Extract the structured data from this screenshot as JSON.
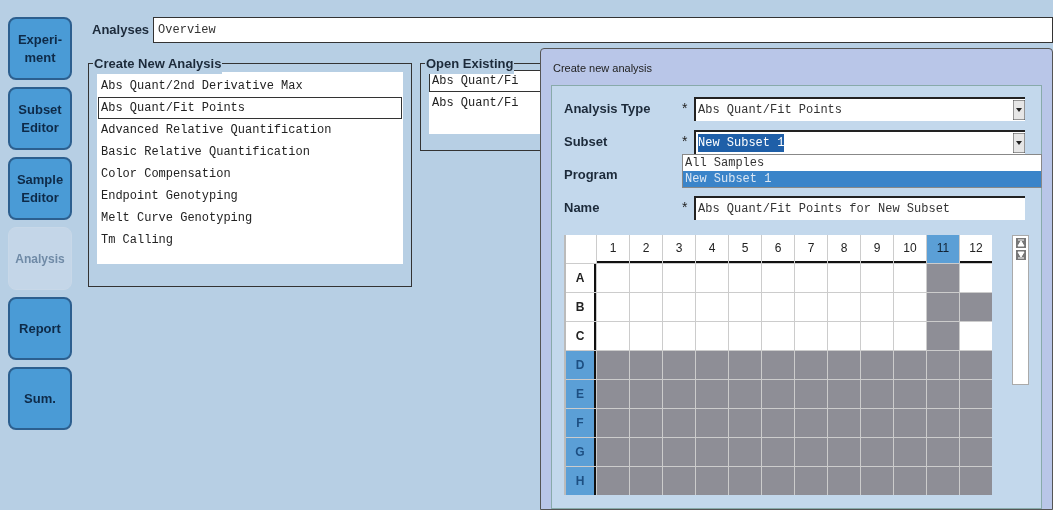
{
  "sidebar": {
    "items": [
      {
        "label": "Experi-\nment",
        "disabled": false
      },
      {
        "label": "Subset\nEditor",
        "disabled": false
      },
      {
        "label": "Sample\nEditor",
        "disabled": false
      },
      {
        "label": "Analysis",
        "disabled": true
      },
      {
        "label": "Report",
        "disabled": false
      },
      {
        "label": "Sum.",
        "disabled": false
      }
    ]
  },
  "analyses": {
    "label": "Analyses",
    "value": "Overview"
  },
  "create_new_analysis": {
    "title": "Create New Analysis",
    "items": [
      {
        "label": "Abs Quant/2nd Derivative Max",
        "selected": false
      },
      {
        "label": "Abs Quant/Fit Points",
        "selected": true
      },
      {
        "label": "Advanced Relative Quantification",
        "selected": false
      },
      {
        "label": "Basic Relative Quantification",
        "selected": false
      },
      {
        "label": "Color Compensation",
        "selected": false
      },
      {
        "label": "Endpoint Genotyping",
        "selected": false
      },
      {
        "label": "Melt Curve Genotyping",
        "selected": false
      },
      {
        "label": "Tm Calling",
        "selected": false
      }
    ]
  },
  "open_existing": {
    "title": "Open Existing",
    "items": [
      {
        "label": "Abs Quant/Fi",
        "selected": true
      },
      {
        "label": "Abs Quant/Fi",
        "selected": false
      }
    ]
  },
  "dialog": {
    "title": "Create new analysis",
    "fields": [
      {
        "label": "Analysis Type",
        "required_mark": "*",
        "value": "Abs Quant/Fit Points",
        "kind": "dropdown"
      },
      {
        "label": "Subset",
        "required_mark": "*",
        "value": "New Subset 1",
        "kind": "dropdown"
      },
      {
        "label": "Program",
        "kind": "label"
      },
      {
        "label": "Name",
        "required_mark": "*",
        "value": "Abs Quant/Fit Points for New Subset",
        "kind": "text"
      }
    ],
    "subset_options": [
      {
        "label": "All Samples",
        "selected": false
      },
      {
        "label": "New Subset 1",
        "selected": true
      }
    ],
    "plate": {
      "columns": [
        {
          "label": "1",
          "selected": false
        },
        {
          "label": "2",
          "selected": false
        },
        {
          "label": "3",
          "selected": false
        },
        {
          "label": "4",
          "selected": false
        },
        {
          "label": "5",
          "selected": false
        },
        {
          "label": "6",
          "selected": false
        },
        {
          "label": "7",
          "selected": false
        },
        {
          "label": "8",
          "selected": false
        },
        {
          "label": "9",
          "selected": false
        },
        {
          "label": "10",
          "selected": false
        },
        {
          "label": "11",
          "selected": true
        },
        {
          "label": "12",
          "selected": false
        }
      ],
      "rows": [
        {
          "label": "A",
          "selected": false,
          "wells": [
            false,
            false,
            false,
            false,
            false,
            false,
            false,
            false,
            false,
            false,
            true,
            false
          ]
        },
        {
          "label": "B",
          "selected": false,
          "wells": [
            false,
            false,
            false,
            false,
            false,
            false,
            false,
            false,
            false,
            false,
            true,
            true
          ]
        },
        {
          "label": "C",
          "selected": false,
          "wells": [
            false,
            false,
            false,
            false,
            false,
            false,
            false,
            false,
            false,
            false,
            true,
            false
          ]
        },
        {
          "label": "D",
          "selected": true,
          "wells": [
            true,
            true,
            true,
            true,
            true,
            true,
            true,
            true,
            true,
            true,
            true,
            true
          ]
        },
        {
          "label": "E",
          "selected": true,
          "wells": [
            true,
            true,
            true,
            true,
            true,
            true,
            true,
            true,
            true,
            true,
            true,
            true
          ]
        },
        {
          "label": "F",
          "selected": true,
          "wells": [
            true,
            true,
            true,
            true,
            true,
            true,
            true,
            true,
            true,
            true,
            true,
            true
          ]
        },
        {
          "label": "G",
          "selected": true,
          "wells": [
            true,
            true,
            true,
            true,
            true,
            true,
            true,
            true,
            true,
            true,
            true,
            true
          ]
        },
        {
          "label": "H",
          "selected": true,
          "wells": [
            true,
            true,
            true,
            true,
            true,
            true,
            true,
            true,
            true,
            true,
            true,
            true
          ]
        }
      ]
    }
  }
}
